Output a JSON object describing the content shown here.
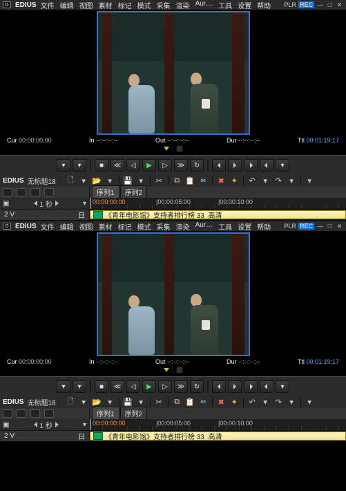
{
  "app": {
    "brand": "EDIUS",
    "logo": "G",
    "menu": [
      "文件",
      "编辑",
      "视图",
      "素材",
      "标记",
      "模式",
      "采集",
      "渲染",
      "Aur…",
      "工具",
      "设置",
      "帮助"
    ],
    "win": {
      "plr": "PLR",
      "rec": "REC"
    }
  },
  "monitor": {
    "cur_label": "Cur",
    "cur": "00:00:00;00",
    "in_label": "In",
    "in": "--:--:--;--",
    "out_label": "Out",
    "out": "--:--:--;--",
    "dur_label": "Dur",
    "dur": "--:--:--;--",
    "ttl_label": "Ttl",
    "ttl": "00:01:19;17"
  },
  "timeline": {
    "brand": "EDIUS",
    "project": "无标题18",
    "icons": [
      "new",
      "open",
      "save",
      "sep",
      "tool",
      "sep",
      "cut",
      "copy",
      "paste",
      "link",
      "sep",
      "fx-del",
      "fx",
      "sep",
      "undo",
      "redo",
      "sep",
      "more"
    ],
    "tabs": [
      "序列1",
      "序列2"
    ],
    "active_tab": 0,
    "left2": {
      "sec": "1 秒"
    },
    "ruler": {
      "origin": "00:00:00:00",
      "t1": "|00:00:05:00",
      "t2": "|00:00:10:00"
    },
    "track": {
      "name": "2 V",
      "marker": "日"
    },
    "clip": {
      "title": "《青年电影馆》支持者排行榜 33_高清"
    }
  }
}
